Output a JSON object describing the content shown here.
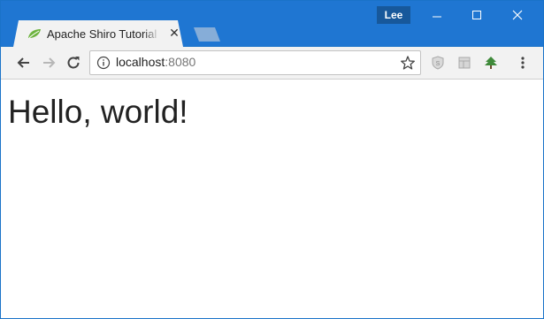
{
  "browser": {
    "tab": {
      "title": "Apache Shiro Tutorial Webapp",
      "favicon": "spring-leaf-icon",
      "close_glyph": "✕"
    },
    "profile_name": "Lee",
    "window_controls": [
      "minimize-icon",
      "maximize-icon",
      "close-icon"
    ],
    "nav": [
      "back-arrow-icon",
      "forward-arrow-icon",
      "reload-icon"
    ],
    "address_bar": {
      "host": "localhost",
      "port": ":8080",
      "security_icon": "info-icon",
      "bookmark_icon": "star-icon"
    },
    "extensions": [
      "shield-extension-icon",
      "layout-extension-icon",
      "tree-extension-icon",
      "menu-dots-icon"
    ],
    "colors": {
      "titlebar": "#1f76d2",
      "profile_badge": "#17589b",
      "toolbar": "#f2f2f2"
    }
  },
  "page": {
    "heading": "Hello, world!"
  }
}
